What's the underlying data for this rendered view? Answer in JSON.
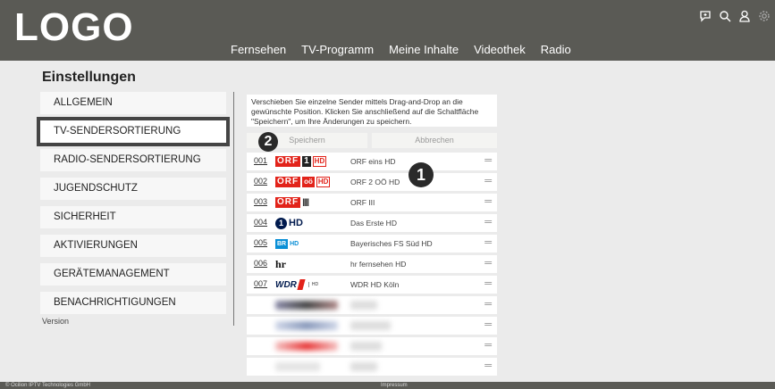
{
  "header": {
    "logo": "LOGO",
    "nav": [
      "Fernsehen",
      "TV-Programm",
      "Meine Inhalte",
      "Videothek",
      "Radio"
    ],
    "icons": [
      "chat-plus-icon",
      "search-icon",
      "user-icon",
      "gear-icon"
    ]
  },
  "page": {
    "title": "Einstellungen"
  },
  "menu": {
    "items": [
      "ALLGEMEIN",
      "TV-SENDERSORTIERUNG",
      "RADIO-SENDERSORTIERUNG",
      "JUGENDSCHUTZ",
      "SICHERHEIT",
      "AKTIVIERUNGEN",
      "GERÄTEMANAGEMENT",
      "BENACHRICHTIGUNGEN"
    ],
    "active_index": 1,
    "version": "Version"
  },
  "info": {
    "text": "Verschieben Sie einzelne Sender mittels Drag-and-Drop an die gewünschte Position. Klicken Sie anschließend auf die Schaltfläche \"Speichern\", um Ihre Änderungen zu speichern."
  },
  "buttons": {
    "save": "Speichern",
    "cancel": "Abbrechen"
  },
  "badges": {
    "one": "1",
    "two": "2"
  },
  "channels": [
    {
      "num": "001",
      "name": "ORF eins HD",
      "logo": "ORF 1 HD"
    },
    {
      "num": "002",
      "name": "ORF 2 OÖ HD",
      "logo": "ORF 2 OÖ HD"
    },
    {
      "num": "003",
      "name": "ORF III",
      "logo": "ORF III"
    },
    {
      "num": "004",
      "name": "Das Erste HD",
      "logo": "1 HD"
    },
    {
      "num": "005",
      "name": "Bayerisches FS Süd HD",
      "logo": "BR HD"
    },
    {
      "num": "006",
      "name": "hr fernsehen HD",
      "logo": "hr"
    },
    {
      "num": "007",
      "name": "WDR HD Köln",
      "logo": "WDR"
    }
  ],
  "footer": {
    "left": "© Ocilion IPTV Technologies GmbH",
    "center": "Impressum"
  }
}
